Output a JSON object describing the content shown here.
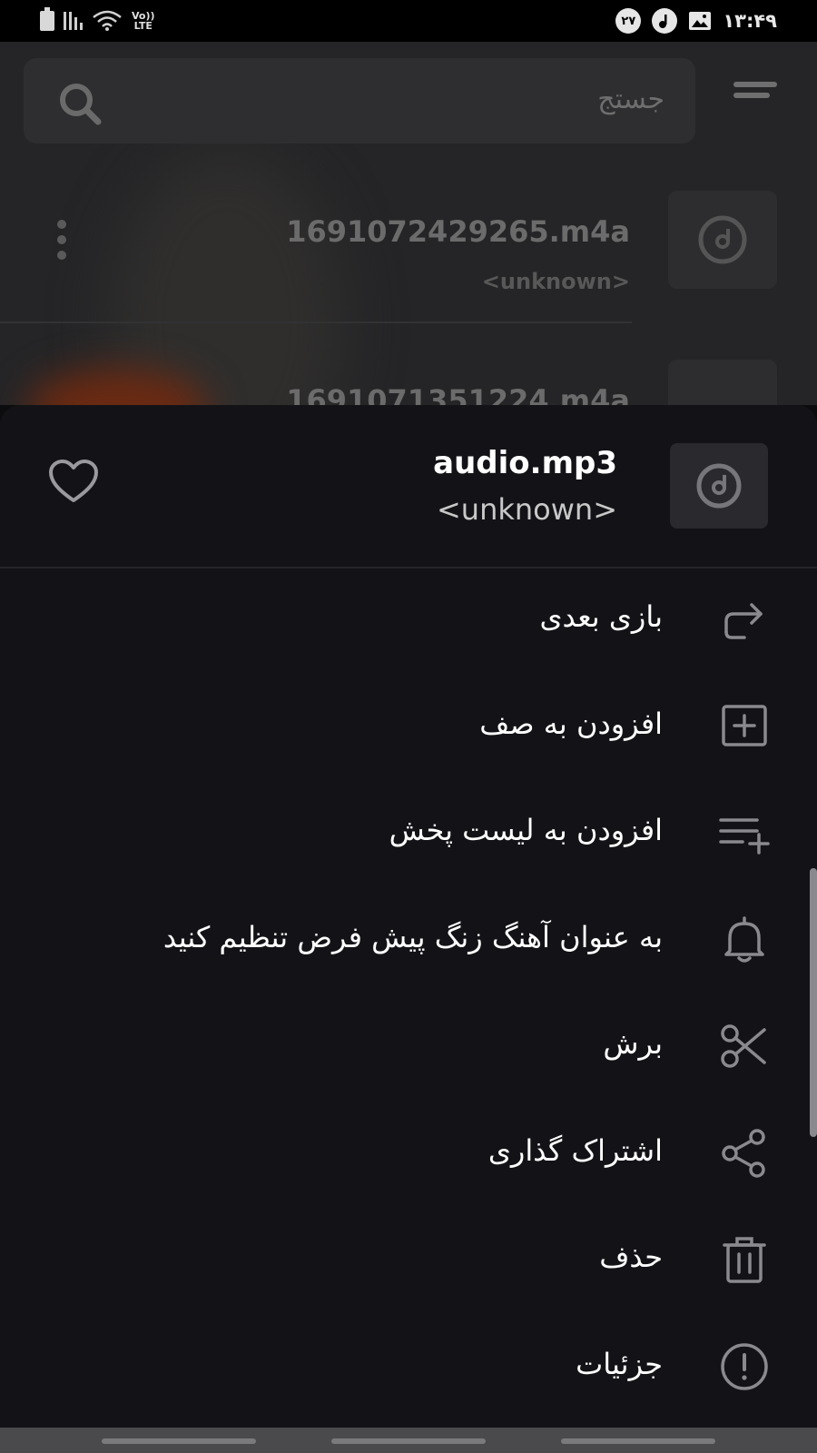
{
  "status_bar": {
    "time": "۱۳:۴۹",
    "notification_count": "۲۷",
    "network_label_top": "Vo))",
    "network_label_bottom": "LTE"
  },
  "search": {
    "placeholder": "جستج"
  },
  "background_list": {
    "items": [
      {
        "title": "1691072429265.m4a",
        "subtitle": "<unknown>"
      },
      {
        "title": "1691071351224.m4a",
        "subtitle": ""
      }
    ]
  },
  "sheet": {
    "track_title": "audio.mp3",
    "track_artist": "<unknown>",
    "menu": [
      {
        "label": "بازی بعدی",
        "icon": "play-next-icon"
      },
      {
        "label": "افزودن به صف",
        "icon": "add-to-queue-icon"
      },
      {
        "label": "افزودن به لیست پخش",
        "icon": "add-to-playlist-icon"
      },
      {
        "label": "به عنوان آهنگ زنگ پیش فرض تنظیم کنید",
        "icon": "bell-icon"
      },
      {
        "label": "برش",
        "icon": "scissors-icon"
      },
      {
        "label": "اشتراک گذاری",
        "icon": "share-icon"
      },
      {
        "label": "حذف",
        "icon": "trash-icon"
      },
      {
        "label": "جزئیات",
        "icon": "info-icon"
      }
    ]
  },
  "colors": {
    "sheet_background": "#131317",
    "icon_gray": "#8a8a8e",
    "text_primary": "#ffffff"
  }
}
